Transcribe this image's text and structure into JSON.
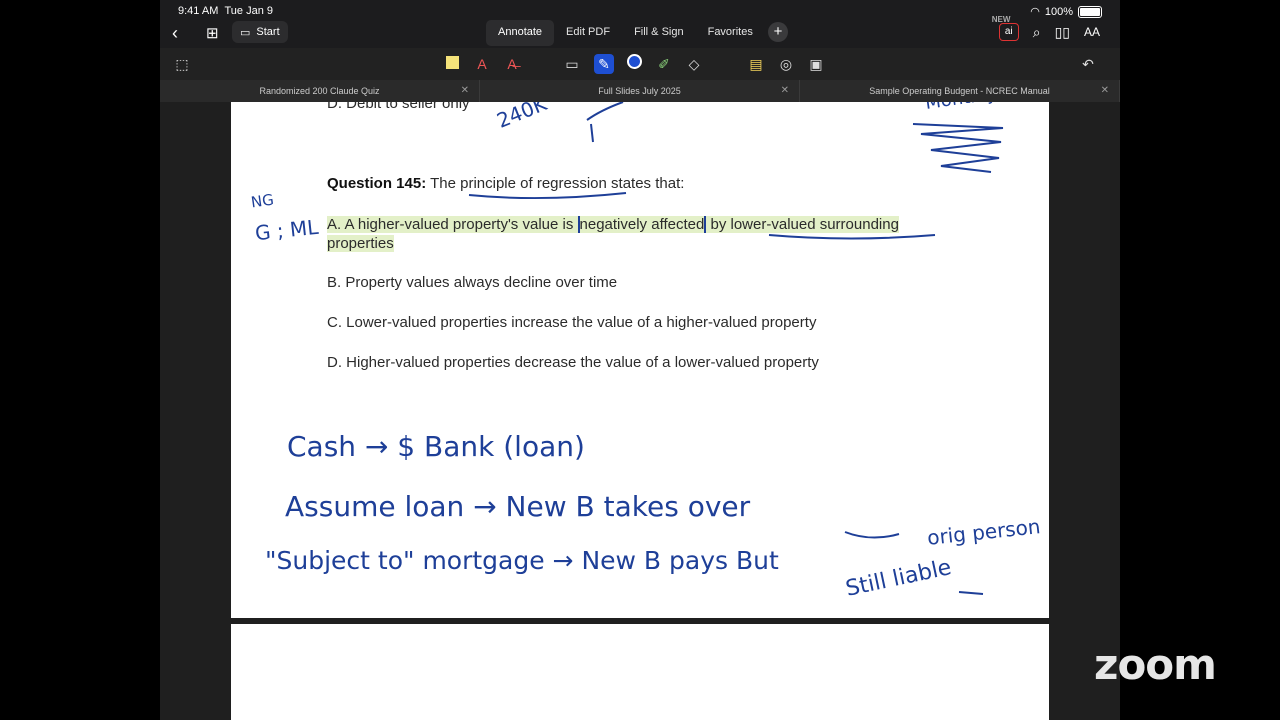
{
  "status": {
    "time": "9:41 AM",
    "date": "Tue Jan 9",
    "battery": "100%"
  },
  "nav": {
    "start_label": "Start",
    "modes": [
      "Annotate",
      "Edit PDF",
      "Fill & Sign",
      "Favorites"
    ],
    "new_badge": "NEW",
    "ai_label": "ai"
  },
  "tabs": [
    {
      "label": "Randomized 200 Claude Quiz"
    },
    {
      "label": "Full Slides July 2025"
    },
    {
      "label": "Sample Operating Budgent - NCREC Manual"
    }
  ],
  "document": {
    "prev_option": "D. Debit to seller only",
    "question_number": "Question 145:",
    "question_text": "The principle of regression states that:",
    "option_a_prefix": "A. A higher-valued property's value is ",
    "option_a_mid": "negatively affected",
    "option_a_suffix": " by lower-valued surrounding properties",
    "option_b": "B. Property values always decline over time",
    "option_c": "C. Lower-valued properties increase the value of a higher-valued property",
    "option_d": "D. Higher-valued properties decrease the value of a lower-valued property"
  },
  "handwriting": {
    "top_mid": "240K",
    "top_right": "Monthly",
    "margin_top": "NG",
    "margin_bottom": "G ; ML",
    "line1": "Cash → $ Bank (loan)",
    "line2": "Assume loan → New B takes over",
    "line3a": "\"Subject to\" mortgage → New B pays But",
    "line3b": "orig person",
    "line3c": "Still liable"
  },
  "watermark": "zoom",
  "colors": {
    "ink": "#1e3f98",
    "highlight": "#e3f0c8",
    "accent_ai": "#d33"
  }
}
